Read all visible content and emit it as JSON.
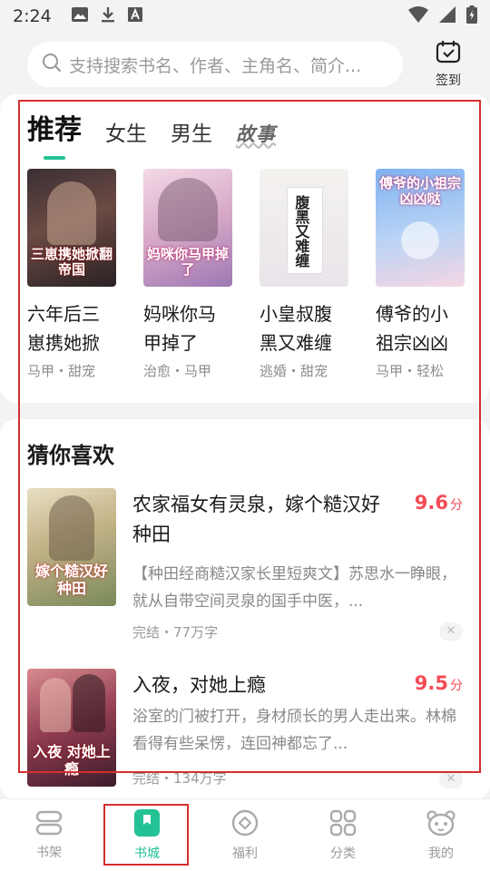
{
  "status_bar": {
    "time": "2:24"
  },
  "search": {
    "placeholder": "支持搜索书名、作者、主角名、简介..."
  },
  "checkin": {
    "label": "签到"
  },
  "tabs": [
    {
      "label": "推荐",
      "active": true
    },
    {
      "label": "女生",
      "active": false
    },
    {
      "label": "男生",
      "active": false
    },
    {
      "label": "故事",
      "active": false
    }
  ],
  "recommend_books": [
    {
      "title": "六年后三崽携她掀",
      "tags": "马甲・甜宠",
      "cover_text": "三崽携她掀翻帝国"
    },
    {
      "title": "妈咪你马甲掉了",
      "tags": "治愈・马甲",
      "cover_text": "妈咪你马甲掉了"
    },
    {
      "title": "小皇叔腹黑又难缠",
      "tags": "逃婚・甜宠",
      "cover_text": "腹黑又难缠"
    },
    {
      "title": "傅爷的小祖宗凶凶",
      "tags": "马甲・轻松",
      "cover_text": "傅爷的小祖宗凶凶哒"
    }
  ],
  "guess": {
    "title": "猜你喜欢",
    "items": [
      {
        "title": "农家福女有灵泉，嫁个糙汉好种田",
        "score": "9.6",
        "score_unit": "分",
        "description": "【种田经商糙汉家长里短爽文】苏思水一睁眼，就从自带空间灵泉的国手中医，...",
        "meta": "完结・77万字",
        "cover_text": "嫁个糙汉好种田"
      },
      {
        "title": "入夜，对她上瘾",
        "score": "9.5",
        "score_unit": "分",
        "description": "浴室的门被打开，身材颀长的男人走出来。林棉看得有些呆愣，连回神都忘了...",
        "meta": "完结・134万字",
        "cover_text": "入夜 对她上瘾"
      }
    ]
  },
  "bottom_nav": [
    {
      "label": "书架",
      "icon": "bookshelf-icon",
      "active": false
    },
    {
      "label": "书城",
      "icon": "bookstore-icon",
      "active": true
    },
    {
      "label": "福利",
      "icon": "welfare-icon",
      "active": false
    },
    {
      "label": "分类",
      "icon": "category-icon",
      "active": false
    },
    {
      "label": "我的",
      "icon": "profile-icon",
      "active": false
    }
  ],
  "colors": {
    "accent": "#22c295",
    "score": "#f44b55",
    "highlight": "#d32f2f"
  }
}
